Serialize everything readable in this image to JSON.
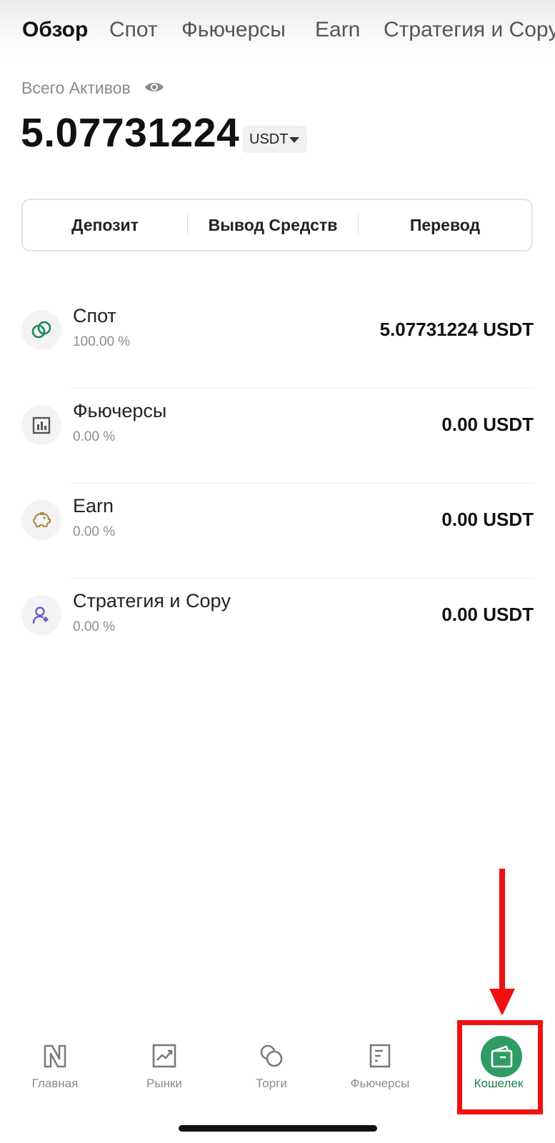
{
  "top_tabs": [
    {
      "label": "Обзор",
      "active": true
    },
    {
      "label": "Спот",
      "active": false
    },
    {
      "label": "Фьючерсы",
      "active": false
    },
    {
      "label": "Earn",
      "active": false
    },
    {
      "label": "Стратегия и Copy",
      "active": false
    }
  ],
  "overview": {
    "assets_label": "Всего Активов",
    "balance": "5.07731224",
    "currency": "USDT"
  },
  "actions": {
    "deposit": "Депозит",
    "withdraw": "Вывод Средств",
    "transfer": "Перевод"
  },
  "accounts": [
    {
      "name": "Спот",
      "percent": "100.00 %",
      "value": "5.07731224 USDT",
      "icon": "spot-coins-icon",
      "color": "#1e8a55"
    },
    {
      "name": "Фьючерсы",
      "percent": "0.00 %",
      "value": "0.00 USDT",
      "icon": "futures-chart-icon",
      "color": "#555555"
    },
    {
      "name": "Earn",
      "percent": "0.00 %",
      "value": "0.00 USDT",
      "icon": "piggy-bank-icon",
      "color": "#b08a4a"
    },
    {
      "name": "Стратегия и Copy",
      "percent": "0.00 %",
      "value": "0.00 USDT",
      "icon": "user-copy-icon",
      "color": "#6a5cc2"
    }
  ],
  "bottom_nav": [
    {
      "label": "Главная",
      "icon": "home-logo-icon",
      "active": false
    },
    {
      "label": "Рынки",
      "icon": "markets-chart-icon",
      "active": false
    },
    {
      "label": "Торги",
      "icon": "trade-circles-icon",
      "active": false
    },
    {
      "label": "Фьючерсы",
      "icon": "futures-doc-icon",
      "active": false
    },
    {
      "label": "Кошелек",
      "icon": "wallet-icon",
      "active": true
    }
  ],
  "colors": {
    "accent_green": "#2f9d63",
    "annotation_red": "#ee1111"
  }
}
